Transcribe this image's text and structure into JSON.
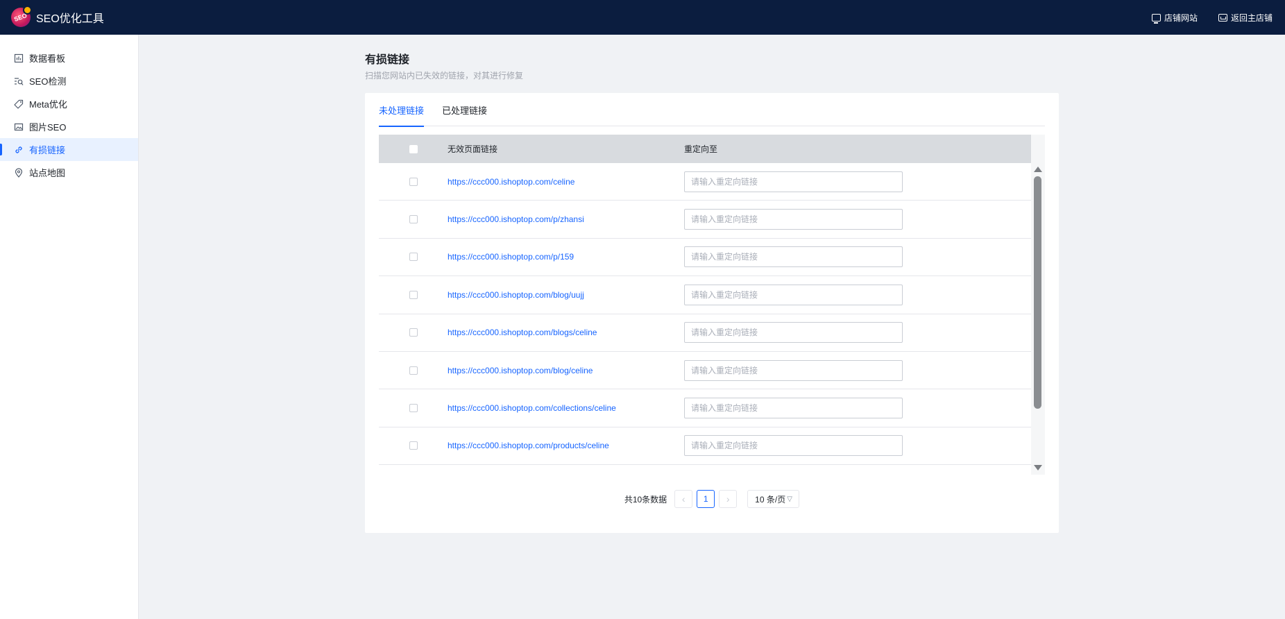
{
  "app": {
    "title": "SEO优化工具",
    "logo_text": "SEO"
  },
  "header_actions": [
    {
      "label": "店铺网站",
      "icon": "monitor-icon"
    },
    {
      "label": "返回主店铺",
      "icon": "store-icon"
    }
  ],
  "sidebar": {
    "items": [
      {
        "label": "数据看板",
        "icon": "chart-board-icon",
        "active": false
      },
      {
        "label": "SEO检测",
        "icon": "search-list-icon",
        "active": false
      },
      {
        "label": "Meta优化",
        "icon": "tag-icon",
        "active": false
      },
      {
        "label": "图片SEO",
        "icon": "image-icon",
        "active": false
      },
      {
        "label": "有损链接",
        "icon": "link-icon",
        "active": true
      },
      {
        "label": "站点地图",
        "icon": "location-pin-icon",
        "active": false
      }
    ]
  },
  "page": {
    "title": "有损链接",
    "subtitle": "扫描您网站内已失效的链接，对其进行修复"
  },
  "tabs": [
    {
      "label": "未处理链接",
      "active": true
    },
    {
      "label": "已处理链接",
      "active": false
    }
  ],
  "table": {
    "columns": [
      "无效页面链接",
      "重定向至"
    ],
    "placeholder": "请输入重定向链接",
    "rows": [
      {
        "url": "https://ccc000.ishoptop.com/celine"
      },
      {
        "url": "https://ccc000.ishoptop.com/p/zhansi"
      },
      {
        "url": "https://ccc000.ishoptop.com/p/159"
      },
      {
        "url": "https://ccc000.ishoptop.com/blog/uujj"
      },
      {
        "url": "https://ccc000.ishoptop.com/blogs/celine"
      },
      {
        "url": "https://ccc000.ishoptop.com/blog/celine"
      },
      {
        "url": "https://ccc000.ishoptop.com/collections/celine"
      },
      {
        "url": "https://ccc000.ishoptop.com/products/celine"
      }
    ]
  },
  "pagination": {
    "total_text": "共10条数据",
    "current_page": "1",
    "page_size": "10 条/页",
    "prev": "‹",
    "next": "›"
  },
  "colors": {
    "header_bg": "#0b1d3f",
    "accent": "#1664ff",
    "page_bg": "#f0f2f5"
  }
}
